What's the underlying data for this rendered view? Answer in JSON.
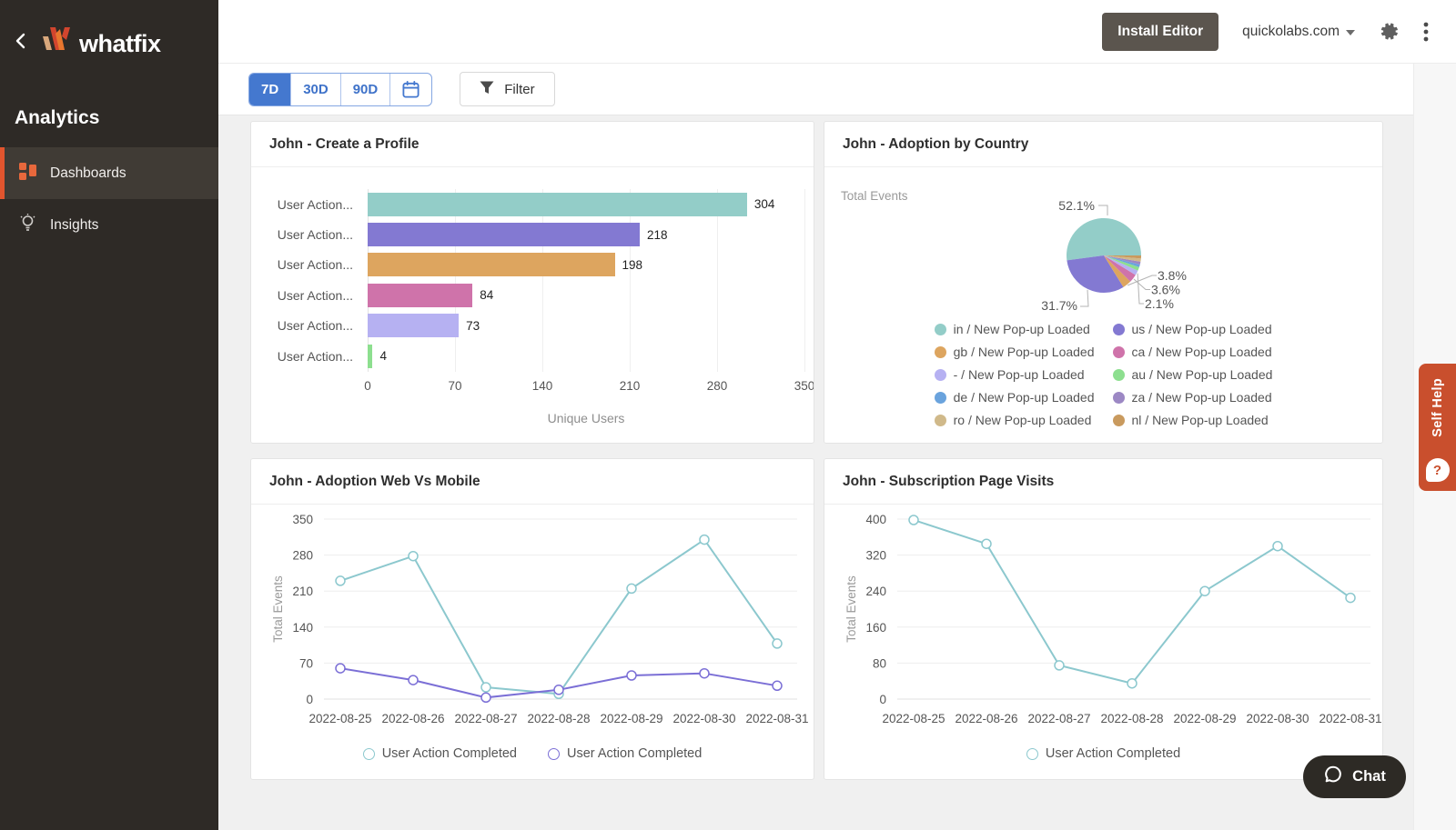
{
  "sidebar": {
    "brand": "whatfix",
    "section": "Analytics",
    "items": [
      {
        "label": "Dashboards",
        "active": true
      },
      {
        "label": "Insights",
        "active": false
      }
    ]
  },
  "topbar": {
    "install_label": "Install Editor",
    "account": "quickolabs.com"
  },
  "filterbar": {
    "ranges": [
      "7D",
      "30D",
      "90D"
    ],
    "active_range": "7D",
    "filter_label": "Filter"
  },
  "widgets": {
    "self_help_label": "Self Help",
    "chat_label": "Chat"
  },
  "colors": {
    "accent_blue": "#4478cf",
    "brand_orange": "#e2552e",
    "sidebar_bg": "#2e2a26",
    "teal": "#93cdc8",
    "purple": "#8379d2"
  },
  "chart_data": [
    {
      "type": "bar",
      "title": "John - Create a Profile",
      "categories": [
        "User Action...",
        "User Action...",
        "User Action...",
        "User Action...",
        "User Action...",
        "User Action..."
      ],
      "values": [
        304,
        218,
        198,
        84,
        73,
        4
      ],
      "colors": [
        "#93cdc8",
        "#8379d2",
        "#dda55f",
        "#cf73aa",
        "#b6b1f2",
        "#8ddf8f"
      ],
      "xlabel": "Unique Users",
      "xticks": [
        0,
        70,
        140,
        210,
        280,
        350
      ],
      "xlim": [
        0,
        350
      ],
      "grid": true
    },
    {
      "type": "pie",
      "title": "John - Adoption by Country",
      "axis_label": "Total Events",
      "legend_position": "bottom",
      "slices": [
        {
          "label": "in / New Pop-up Loaded",
          "value": 52.1,
          "pct": "52.1%",
          "color": "#93cdc8"
        },
        {
          "label": "us / New Pop-up Loaded",
          "value": 31.7,
          "pct": "31.7%",
          "color": "#8379d2"
        },
        {
          "label": "gb / New Pop-up Loaded",
          "value": 3.8,
          "pct": "3.8%",
          "color": "#dda55f"
        },
        {
          "label": "ca / New Pop-up Loaded",
          "value": 3.6,
          "pct": "3.6%",
          "color": "#cf73aa"
        },
        {
          "label": "- / New Pop-up Loaded",
          "value": 2.1,
          "pct": "2.1%",
          "color": "#b6b1f2"
        },
        {
          "label": "au / New Pop-up Loaded",
          "value": 1.6,
          "pct": null,
          "color": "#8ddf8f"
        },
        {
          "label": "de / New Pop-up Loaded",
          "value": 1.2,
          "pct": null,
          "color": "#6aa3dd"
        },
        {
          "label": "za / New Pop-up Loaded",
          "value": 1.2,
          "pct": null,
          "color": "#9c88c4"
        },
        {
          "label": "ro / New Pop-up Loaded",
          "value": 1.4,
          "pct": null,
          "color": "#d0b98a"
        },
        {
          "label": "nl / New Pop-up Loaded",
          "value": 1.3,
          "pct": null,
          "color": "#c99a5e"
        }
      ]
    },
    {
      "type": "line",
      "title": "John - Adoption Web Vs Mobile",
      "ylabel": "Total Events",
      "x": [
        "2022-08-25",
        "2022-08-26",
        "2022-08-27",
        "2022-08-28",
        "2022-08-29",
        "2022-08-30",
        "2022-08-31"
      ],
      "ylim": [
        0,
        350
      ],
      "yticks": [
        0,
        70,
        140,
        210,
        280,
        350
      ],
      "grid": true,
      "legend_position": "bottom",
      "series": [
        {
          "name": "User Action Completed",
          "color": "#8cc8ce",
          "values": [
            230,
            278,
            23,
            10,
            215,
            310,
            108
          ]
        },
        {
          "name": "User Action Completed",
          "color": "#7b6fd6",
          "values": [
            60,
            37,
            3,
            18,
            46,
            50,
            26
          ]
        }
      ]
    },
    {
      "type": "line",
      "title": "John - Subscription Page Visits",
      "ylabel": "Total Events",
      "x": [
        "2022-08-25",
        "2022-08-26",
        "2022-08-27",
        "2022-08-28",
        "2022-08-29",
        "2022-08-30",
        "2022-08-31"
      ],
      "ylim": [
        0,
        400
      ],
      "yticks": [
        0,
        80,
        160,
        240,
        320,
        400
      ],
      "grid": true,
      "legend_position": "bottom",
      "series": [
        {
          "name": "User Action Completed",
          "color": "#8cc8ce",
          "values": [
            398,
            345,
            75,
            35,
            240,
            340,
            225
          ]
        }
      ]
    }
  ]
}
